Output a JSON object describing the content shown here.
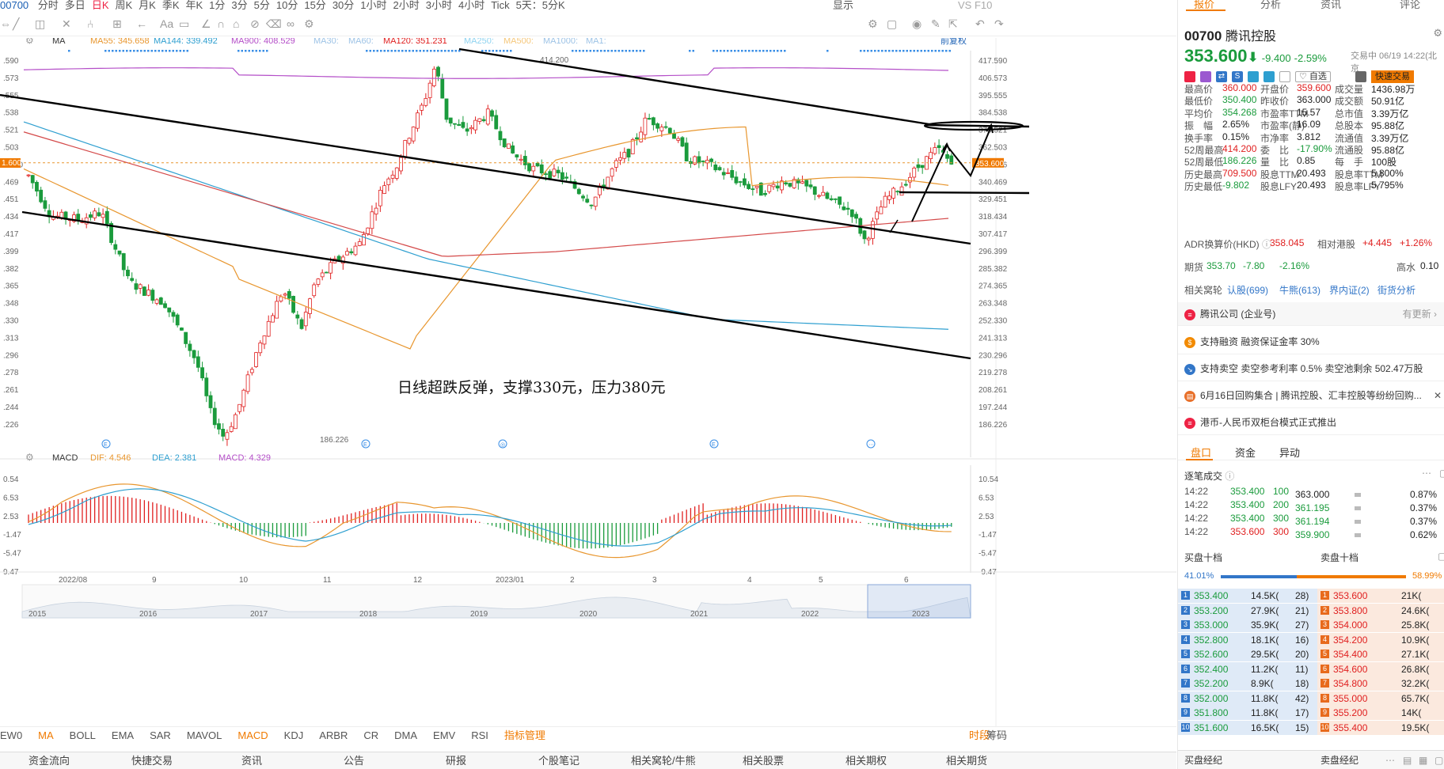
{
  "toolbar": {
    "code": "00700",
    "periods": [
      "分时",
      "多日",
      "日K",
      "周K",
      "月K",
      "季K",
      "年K",
      "1分",
      "3分",
      "5分",
      "10分",
      "15分",
      "30分",
      "1小时",
      "2小时",
      "3小时",
      "4小时",
      "Tick",
      "5天：5分K"
    ],
    "active": "日K",
    "right_labels": [
      "显示",
      "VS F10"
    ]
  },
  "ma_bar": {
    "label": "MA",
    "ma55": "MA55: 345.658",
    "ma144": "MA144: 339.492",
    "ma900": "MA900: 408.529",
    "ma30": "MA30:",
    "ma60": "MA60:",
    "ma120": "MA120: 351.231",
    "ma250": "MA250:",
    "ma500": "MA500:",
    "ma1000": "MA1000:",
    "ma1": "MA1:",
    "adjust": "前复权"
  },
  "macd_bar": {
    "label": "MACD",
    "dif": "DIF: 4.546",
    "dea": "DEA: 2.381",
    "macd": "MACD: 4.329"
  },
  "chart_data": {
    "type": "candlestick",
    "title": "",
    "annotation": "日线超跌反弹，支撑330元，压力380元",
    "high_label": "414.200",
    "low_label": "186.226",
    "price_right_label": "353.600",
    "left_price_label": "1.600",
    "yticks": [
      "417.590",
      "406.573",
      "395.555",
      "384.538",
      "373.521",
      "362.503",
      "351.486",
      "340.469",
      "329.451",
      "318.434",
      "307.417",
      "296.399",
      "285.382",
      "274.365",
      "263.348",
      "252.330",
      "241.313",
      "230.296",
      "219.278",
      "208.261",
      "197.244",
      "186.226"
    ],
    "yticks_left": [
      ".590",
      ".573",
      ".555",
      ".538",
      ".521",
      ".503",
      "1.600",
      ".469",
      ".451",
      ".434",
      ".417",
      ".399",
      ".382",
      ".365",
      ".348",
      ".330",
      ".313",
      ".296",
      ".278",
      ".261",
      ".244",
      ".226"
    ],
    "macd_ticks": [
      "10.54",
      "6.53",
      "2.53",
      "-1.47",
      "-5.47",
      "-9.47"
    ],
    "macd_ticks_left": [
      "0.54",
      "6.53",
      "2.53",
      "-1.47",
      "-5.47",
      "9.47"
    ],
    "xlabels": [
      "2022/08",
      "9",
      "10",
      "11",
      "12",
      "2023/01",
      "2",
      "3",
      "4",
      "5",
      "6"
    ],
    "overview_years": [
      "2015",
      "2016",
      "2017",
      "2018",
      "2019",
      "2020",
      "2021",
      "2022",
      "2023"
    ],
    "ylim": [
      186.226,
      417.59
    ],
    "last_close": 353.6,
    "ma55_last": 345.658,
    "ma144_last": 339.492,
    "ma900_last": 408.529,
    "ma120_last": 351.231,
    "dif_last": 4.546,
    "dea_last": 2.381,
    "macd_last": 4.329
  },
  "indicators": [
    "EW0",
    "MA",
    "BOLL",
    "EMA",
    "SAR",
    "MAVOL",
    "MACD",
    "KDJ",
    "ARBR",
    "CR",
    "DMA",
    "EMV",
    "RSI",
    "指标管理"
  ],
  "indicators_right": [
    "时段",
    "筹码"
  ],
  "bottom_nav": [
    "资金流向",
    "快捷交易",
    "资讯",
    "公告",
    "研报",
    "个股笔记",
    "相关窝轮/牛熊",
    "相关股票",
    "相关期权",
    "相关期货"
  ],
  "right": {
    "tabs": [
      "报价",
      "分析",
      "资讯",
      "评论"
    ],
    "code": "00700",
    "name": "腾讯控股",
    "price": "353.600",
    "arrow": "⬇",
    "change": "-9.400",
    "pct": "-2.59%",
    "time": "交易中 06/19 14:22(北京",
    "fav": "自选",
    "quick": "快速交易",
    "stats": [
      [
        "最高价",
        "360.000",
        "r",
        "开盘价",
        "359.600",
        "r",
        "成交量",
        "1436.98万",
        "k"
      ],
      [
        "最低价",
        "350.400",
        "g",
        "昨收价",
        "363.000",
        "k",
        "成交额",
        "50.91亿",
        "k"
      ],
      [
        "平均价",
        "354.268",
        "g",
        "市盈率TTM",
        "15.57",
        "k",
        "总市值",
        "3.39万亿",
        "k"
      ],
      [
        "振　幅",
        "2.65%",
        "k",
        "市盈率(静)",
        "16.09",
        "k",
        "总股本",
        "95.88亿",
        "k"
      ],
      [
        "换手率",
        "0.15%",
        "k",
        "市净率",
        "3.812",
        "k",
        "流通值",
        "3.39万亿",
        "k"
      ],
      [
        "52周最高",
        "414.200",
        "r",
        "委　比",
        "-17.90%",
        "g",
        "流通股",
        "95.88亿",
        "k"
      ],
      [
        "52周最低",
        "186.226",
        "g",
        "量　比",
        "0.85",
        "k",
        "每　手",
        "100股",
        "k"
      ],
      [
        "历史最高",
        "709.500",
        "r",
        "股息TTM",
        "20.493",
        "k",
        "股息率TTM",
        "5.800%",
        "k"
      ],
      [
        "历史最低",
        "-9.802",
        "g",
        "股息LFY",
        "20.493",
        "k",
        "股息率LFY",
        "5.795%",
        "k"
      ]
    ],
    "adr": {
      "label": "ADR换算价(HKD)",
      "value": "358.045",
      "rel": "相对港股",
      "rel_val": "+4.445",
      "rel_pct": "+1.26%"
    },
    "fut": {
      "label": "期货",
      "v1": "353.70",
      "v2": "-7.80",
      "v3": "-2.16%",
      "hl": "高水",
      "hl_v": "0.10"
    },
    "warrants": {
      "label": "相关窝轮",
      "items": [
        "认股(699)",
        "牛熊(613)",
        "界内证(2)",
        "街货分析"
      ]
    },
    "company": {
      "text": "腾讯公司 (企业号)",
      "right": "有更新"
    },
    "news": [
      "支持融资 融资保证金率 30%",
      "支持卖空 卖空参考利率 0.5% 卖空池剩余 502.47万股",
      "6月16日回购集合 | 腾讯控股、汇丰控股等纷纷回购...",
      "港币-人民币双柜台模式正式推出"
    ],
    "subtabs": [
      "盘口",
      "资金",
      "异动"
    ],
    "ticks_label": "逐笔成交",
    "ticks": [
      [
        "14:22",
        "353.400",
        "100",
        "g"
      ],
      [
        "14:22",
        "353.400",
        "200",
        "g"
      ],
      [
        "14:22",
        "353.400",
        "300",
        "g"
      ],
      [
        "14:22",
        "353.600",
        "300",
        "r"
      ]
    ],
    "vol_dist": [
      [
        "363.000",
        "0.87%"
      ],
      [
        "361.195",
        "0.37%"
      ],
      [
        "361.194",
        "0.37%"
      ],
      [
        "359.900",
        "0.62%"
      ]
    ],
    "ob_title": [
      "买盘十档",
      "卖盘十档"
    ],
    "ob_ratio": [
      "41.01%",
      "58.99%"
    ],
    "bids": [
      [
        "1",
        "353.400",
        "14.5K(",
        "28)"
      ],
      [
        "2",
        "353.200",
        "27.9K(",
        "21)"
      ],
      [
        "3",
        "353.000",
        "35.9K(",
        "27)"
      ],
      [
        "4",
        "352.800",
        "18.1K(",
        "16)"
      ],
      [
        "5",
        "352.600",
        "29.5K(",
        "20)"
      ],
      [
        "6",
        "352.400",
        "11.2K(",
        "11)"
      ],
      [
        "7",
        "352.200",
        "8.9K(",
        "18)"
      ],
      [
        "8",
        "352.000",
        "11.8K(",
        "42)"
      ],
      [
        "9",
        "351.800",
        "11.8K(",
        "17)"
      ],
      [
        "10",
        "351.600",
        "16.5K(",
        "15)"
      ]
    ],
    "asks": [
      [
        "1",
        "353.600",
        "21K("
      ],
      [
        "2",
        "353.800",
        "24.6K("
      ],
      [
        "3",
        "354.000",
        "25.8K("
      ],
      [
        "4",
        "354.200",
        "10.9K("
      ],
      [
        "5",
        "354.400",
        "27.1K("
      ],
      [
        "6",
        "354.600",
        "26.8K("
      ],
      [
        "7",
        "354.800",
        "32.2K("
      ],
      [
        "8",
        "355.000",
        "65.7K("
      ],
      [
        "9",
        "355.200",
        "14K("
      ],
      [
        "10",
        "355.400",
        "19.5K("
      ]
    ],
    "broker": [
      "买盘经纪",
      "卖盘经纪"
    ]
  },
  "colors": {
    "up": "#e02020",
    "down": "#1a9b3c",
    "ma55": "#e8962e",
    "ma144": "#2e9fd0",
    "ma900": "#b44ec8",
    "ma120": "#d44a4a",
    "accent": "#f07a00"
  }
}
